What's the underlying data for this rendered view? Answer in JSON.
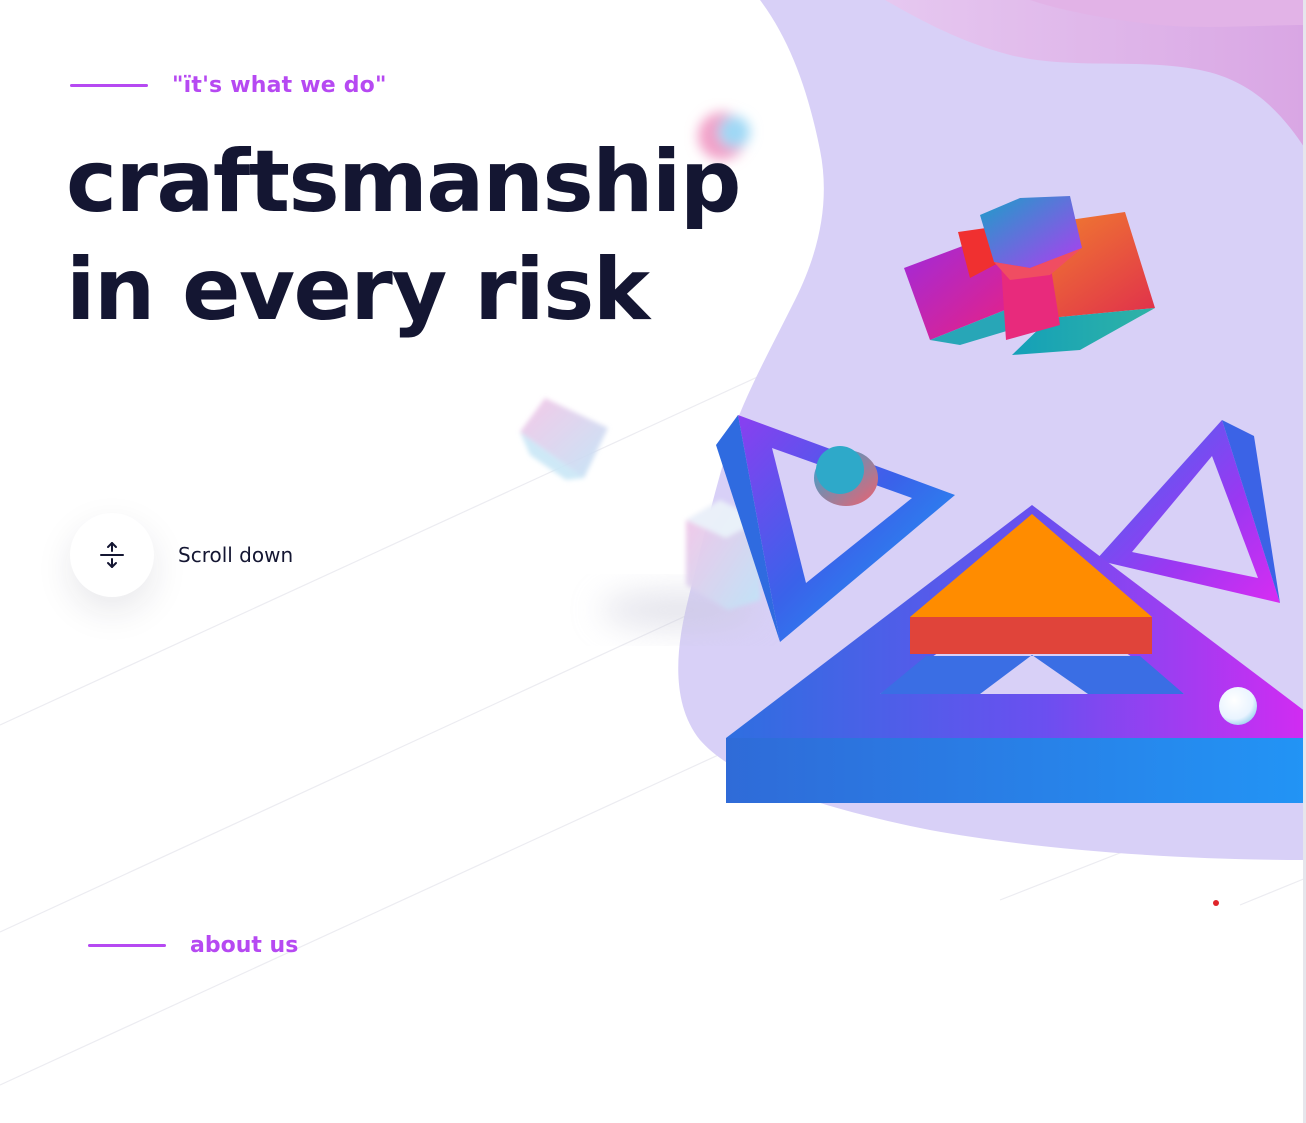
{
  "hero": {
    "eyebrow": "\"ït's what we do\"",
    "headline_line1": "craftsmanship",
    "headline_line2": "in every risk"
  },
  "scroll": {
    "label": "Scroll down",
    "icon": "scroll-arrows-icon"
  },
  "about": {
    "label": "about us"
  },
  "colors": {
    "accent": "#b649f2",
    "heading": "#141632",
    "blob": "#d8d0f7",
    "orange": "#ff8c00",
    "blue": "#2f7ee8"
  }
}
